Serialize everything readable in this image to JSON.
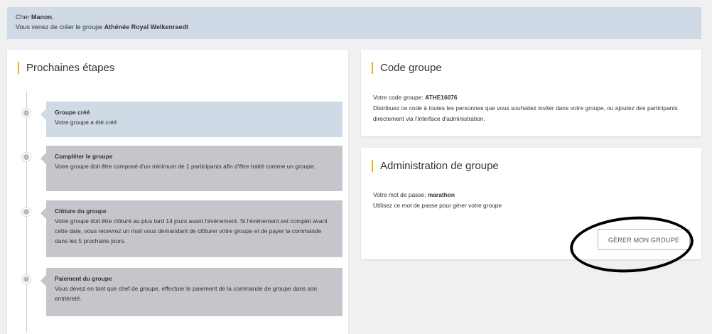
{
  "banner": {
    "greeting_prefix": "Cher ",
    "user_name": "Manon",
    "greeting_suffix": ",",
    "message_prefix": "Vous venez de créer le groupe ",
    "group_name": "Athénée Royal Welkenraedt"
  },
  "steps": {
    "title": "Prochaines étapes",
    "items": [
      {
        "title": "Groupe créé",
        "desc": "Votre groupe a été créé",
        "state": "done"
      },
      {
        "title": "Compléter le groupe",
        "desc": "Votre groupe doit être composé d'un minimum de 1 participants afin d'être traité comme un groupe.",
        "state": "todo"
      },
      {
        "title": "Clôture du groupe",
        "desc": "Votre groupe doit être clôturé au plus tard 14 jours avant l'événement. Si l'événement est complet avant cette date, vous recevrez un mail vous demandant de clôturer votre groupe et de payer la commande dans les 5 prochains jours.",
        "state": "todo"
      },
      {
        "title": "Paiement du groupe",
        "desc": "Vous devez en tant que chef de groupe, effectuer le paiement de la commande de groupe dans son entrièreté.",
        "state": "todo"
      }
    ]
  },
  "code_card": {
    "title": "Code groupe",
    "code_label": "Votre code groupe: ",
    "code_value": "ATHE16076",
    "description": "Distribuez ce code à toutes les personnes que vous souhaitez inviter dans votre groupe, ou ajoutez des participants directement via l'interface d'administration."
  },
  "admin_card": {
    "title": "Administration de groupe",
    "password_label": "Votre mot de passe: ",
    "password_value": "marathon",
    "description": "Utilisez ce mot de passe pour gérer votre groupe",
    "button_label": "GÉRER MON GROUPE"
  },
  "colors": {
    "accent": "#f0b400",
    "banner_bg": "#cfdae6",
    "step_done_bg": "#cfdae6",
    "step_todo_bg": "#c4c6cc"
  }
}
